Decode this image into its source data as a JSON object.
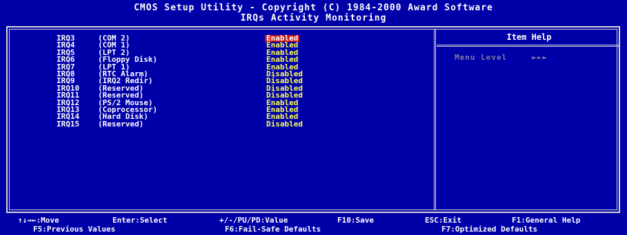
{
  "header": {
    "title_line1": "CMOS Setup Utility - Copyright (C) 1984-2000 Award Software",
    "title_line2": "IRQs Activity Monitoring"
  },
  "irq_items": [
    {
      "irq": "IRQ3",
      "device": "(COM 2)",
      "value": "Enabled",
      "selected": true
    },
    {
      "irq": "IRQ4",
      "device": "(COM 1)",
      "value": "Enabled"
    },
    {
      "irq": "IRQ5",
      "device": "(LPT 2)",
      "value": "Enabled"
    },
    {
      "irq": "IRQ6",
      "device": "(Floppy Disk)",
      "value": "Enabled"
    },
    {
      "irq": "IRQ7",
      "device": "(LPT 1)",
      "value": "Enabled"
    },
    {
      "irq": "IRQ8",
      "device": "(RTC Alarm)",
      "value": "Disabled"
    },
    {
      "irq": "IRQ9",
      "device": "(IRQ2 Redir)",
      "value": "Disabled"
    },
    {
      "irq": "IRQ10",
      "device": "(Reserved)",
      "value": "Disabled"
    },
    {
      "irq": "IRQ11",
      "device": "(Reserved)",
      "value": "Disabled"
    },
    {
      "irq": "IRQ12",
      "device": "(PS/2 Mouse)",
      "value": "Enabled"
    },
    {
      "irq": "IRQ13",
      "device": "(Coprocessor)",
      "value": "Enabled"
    },
    {
      "irq": "IRQ14",
      "device": "(Hard Disk)",
      "value": "Enabled"
    },
    {
      "irq": "IRQ15",
      "device": "(Reserved)",
      "value": "Disabled"
    }
  ],
  "help": {
    "title": "Item Help",
    "menu_level_label": "Menu Level",
    "menu_level_value": "►►►"
  },
  "footer": {
    "move": "↑↓→←:Move",
    "enter": "Enter:Select",
    "value": "+/-/PU/PD:Value",
    "save": "F10:Save",
    "exit": "ESC:Exit",
    "help": "F1:General Help",
    "prev": "F5:Previous Values",
    "failsafe": "F6:Fail-Safe Defaults",
    "optimized": "F7:Optimized Defaults"
  },
  "colors": {
    "background": "#0000a8",
    "value_text": "#ffff55",
    "selected_bg": "#c81818",
    "label_text": "#ffffff"
  }
}
